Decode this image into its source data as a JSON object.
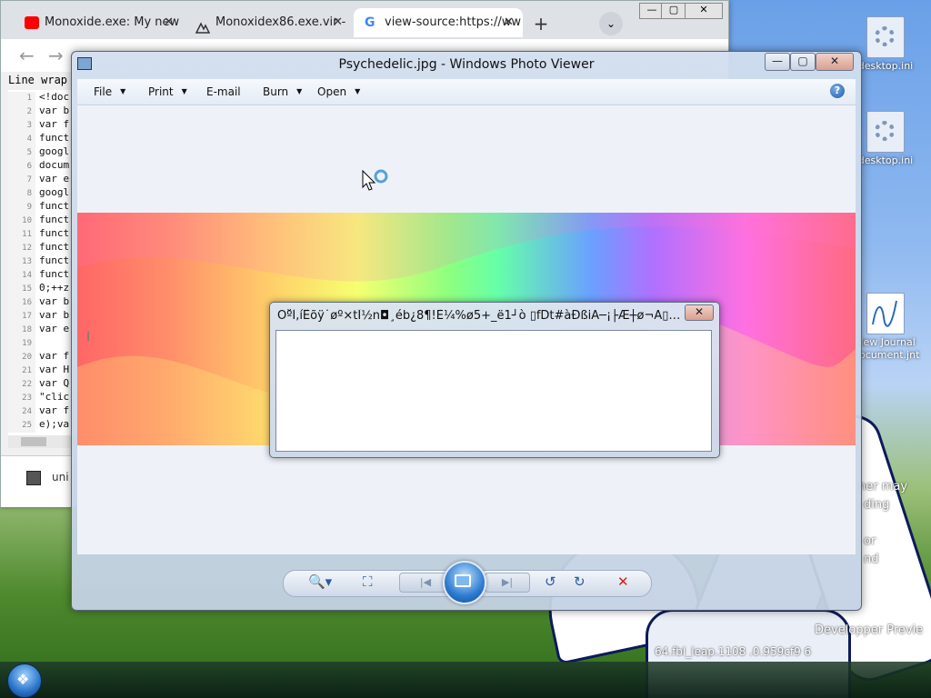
{
  "desktop": {
    "icons": [
      {
        "label": "desktop.ini"
      },
      {
        "label": "desktop.ini"
      },
      {
        "label": "New Journal Document.jnt"
      }
    ],
    "side_text": [
      "ner may",
      "ding",
      "or",
      "nd"
    ],
    "dev_preview_text": "Developper Previe",
    "build_text": "64.fbl_leap.1108 .0.959cf9 6"
  },
  "browser": {
    "tabs": [
      {
        "label": "Monoxide.exe: My new",
        "icon": "youtube-icon",
        "close": "✕"
      },
      {
        "label": "Monoxidex86.exe.vir -",
        "icon": "virustotal-icon",
        "close": "✕"
      },
      {
        "label": "view-source:https://ww",
        "icon": "google-icon",
        "close": "✕"
      }
    ],
    "new_tab": "+",
    "tab_search": "⌄",
    "controls": {
      "minimize": "—",
      "maximize": "▢",
      "close": "✕"
    },
    "toolbar_label": "Line wrap",
    "source_lines": [
      {
        "n": "1",
        "code": "<!doc"
      },
      {
        "n": "2",
        "code": "var b"
      },
      {
        "n": "3",
        "code": "var f"
      },
      {
        "n": "4",
        "code": "funct"
      },
      {
        "n": "5",
        "code": "googl"
      },
      {
        "n": "6",
        "code": "docum"
      },
      {
        "n": "7",
        "code": "var e"
      },
      {
        "n": "8",
        "code": "googl"
      },
      {
        "n": "9",
        "code": "funct"
      },
      {
        "n": "10",
        "code": "funct"
      },
      {
        "n": "11",
        "code": "funct"
      },
      {
        "n": "12",
        "code": "funct"
      },
      {
        "n": "13",
        "code": "funct"
      },
      {
        "n": "14",
        "code": "funct"
      },
      {
        "n": "15",
        "code": "0;++z"
      },
      {
        "n": "16",
        "code": "var b"
      },
      {
        "n": "17",
        "code": "var b"
      },
      {
        "n": "18",
        "code": "var e"
      },
      {
        "n": "19",
        "code": ""
      },
      {
        "n": "20",
        "code": "var f"
      },
      {
        "n": "21",
        "code": "var H"
      },
      {
        "n": "22",
        "code": "var Q"
      },
      {
        "n": "23",
        "code": "\"clic"
      },
      {
        "n": "24",
        "code": "var f"
      },
      {
        "n": "25",
        "code": "e);va"
      }
    ],
    "download_item": "uni"
  },
  "viewer": {
    "title": "Psychedelic.jpg - Windows Photo Viewer",
    "controls": {
      "minimize": "—",
      "maximize": "▢",
      "close": "✕"
    },
    "menu": {
      "file": "File",
      "print": "Print",
      "email": "E-mail",
      "burn": "Burn",
      "open": "Open",
      "dropdown_arrow": "▼"
    },
    "help": "?",
    "text_cursor": "I",
    "toolbar_glyphs": {
      "zoom": "🔍▾",
      "fit": "⛶",
      "prev": "|◀",
      "next": "▶|",
      "rotate_ccw": "↺",
      "rotate_cw": "↻",
      "delete": "✕"
    }
  },
  "popup": {
    "title": "Òº̌Ì,íÊõÿ˙øº×tÎ½n◘¸éb¿8¶!È¼%ø5+_ë1┘ò   ▯fDt#àÐßiÄ─¡├Æ┼ø¬A▯*...",
    "close": "✕"
  },
  "taskbar": {
    "start_glyph": "❖"
  },
  "colors": {
    "accent": "#2b7bd0",
    "delete_red": "#d21f1f",
    "window_chrome": "#d2deee"
  }
}
